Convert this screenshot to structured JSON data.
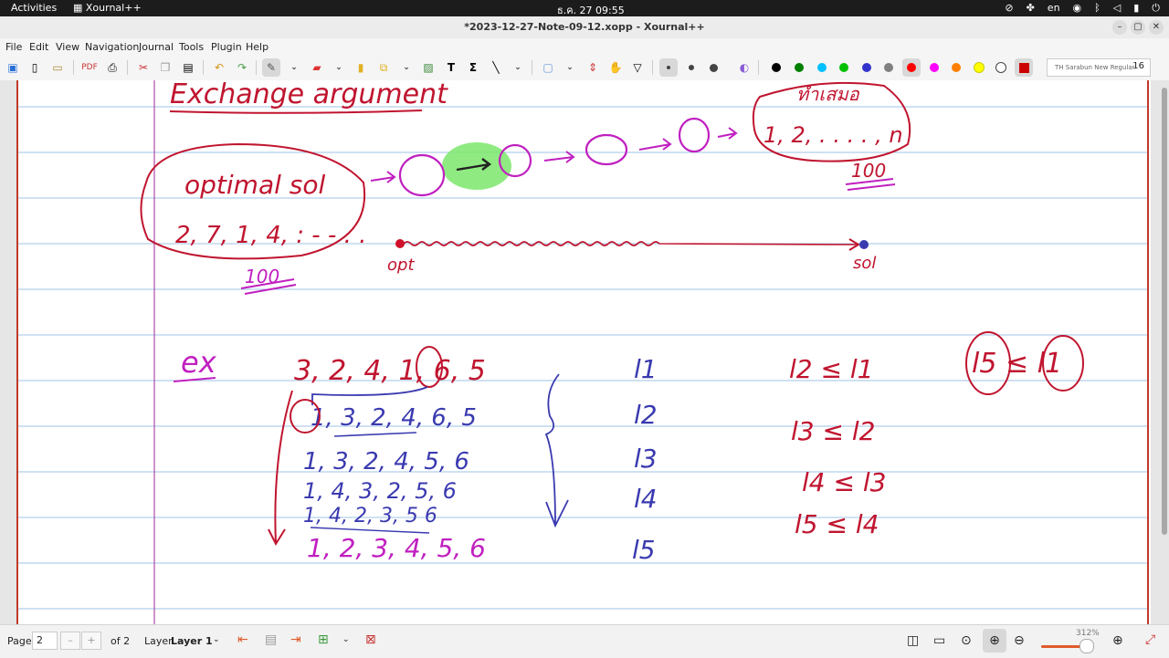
{
  "topbar": {
    "activities": "Activities",
    "app_name": "Xournal++",
    "clock": "ธ.ค. 27  09:55",
    "lang": "en"
  },
  "window": {
    "title": "*2023-12-27-Note-09-12.xopp - Xournal++"
  },
  "menu": [
    "File",
    "Edit",
    "View",
    "Navigation",
    "Journal",
    "Tools",
    "Plugin",
    "Help"
  ],
  "toolbar": {
    "font_name": "TH Sarabun New Regular",
    "font_size": "16",
    "palette": [
      "#000000",
      "#008000",
      "#00c0ff",
      "#00c000",
      "#3333cc",
      "#808080",
      "#ff0000",
      "#ff00ff",
      "#ff8000",
      "#ffff00",
      "#ffffff",
      "#cc0000"
    ]
  },
  "note": {
    "heading": "Exchange argument",
    "optimal_label": "optimal sol",
    "optimal_seq": "2, 7, 1, 4, : - - . .",
    "score_left": "100",
    "sorted_label": "ทำเสมอ",
    "sorted_seq": "1, 2, . . . . , n",
    "score_right": "100",
    "opt_label": "opt",
    "sol_label": "sol",
    "ex_label": "ex",
    "seq_rows": [
      "3, 2, 4, 1, 6, 5",
      "1, 3, 2, 4, 6, 5",
      "1, 3, 2, 4, 5, 6",
      "1, 4, 3, 2, 5, 6",
      "1, 4, 2, 3, 5 6",
      "1, 2, 3, 4, 5, 6"
    ],
    "l_labels": [
      "l1",
      "l2",
      "l3",
      "l4",
      "l5"
    ],
    "ineq": [
      "l2 ≤ l1",
      "l3 ≤ l2",
      "l4 ≤ l3",
      "l5 ≤ l4"
    ],
    "final_ineq": "l5 ≤ l1"
  },
  "bottom": {
    "page_label": "Page",
    "page_value": "2",
    "page_of": "of 2",
    "layer_label": "Layer",
    "layer_value": "Layer 1",
    "zoom": "312%"
  }
}
